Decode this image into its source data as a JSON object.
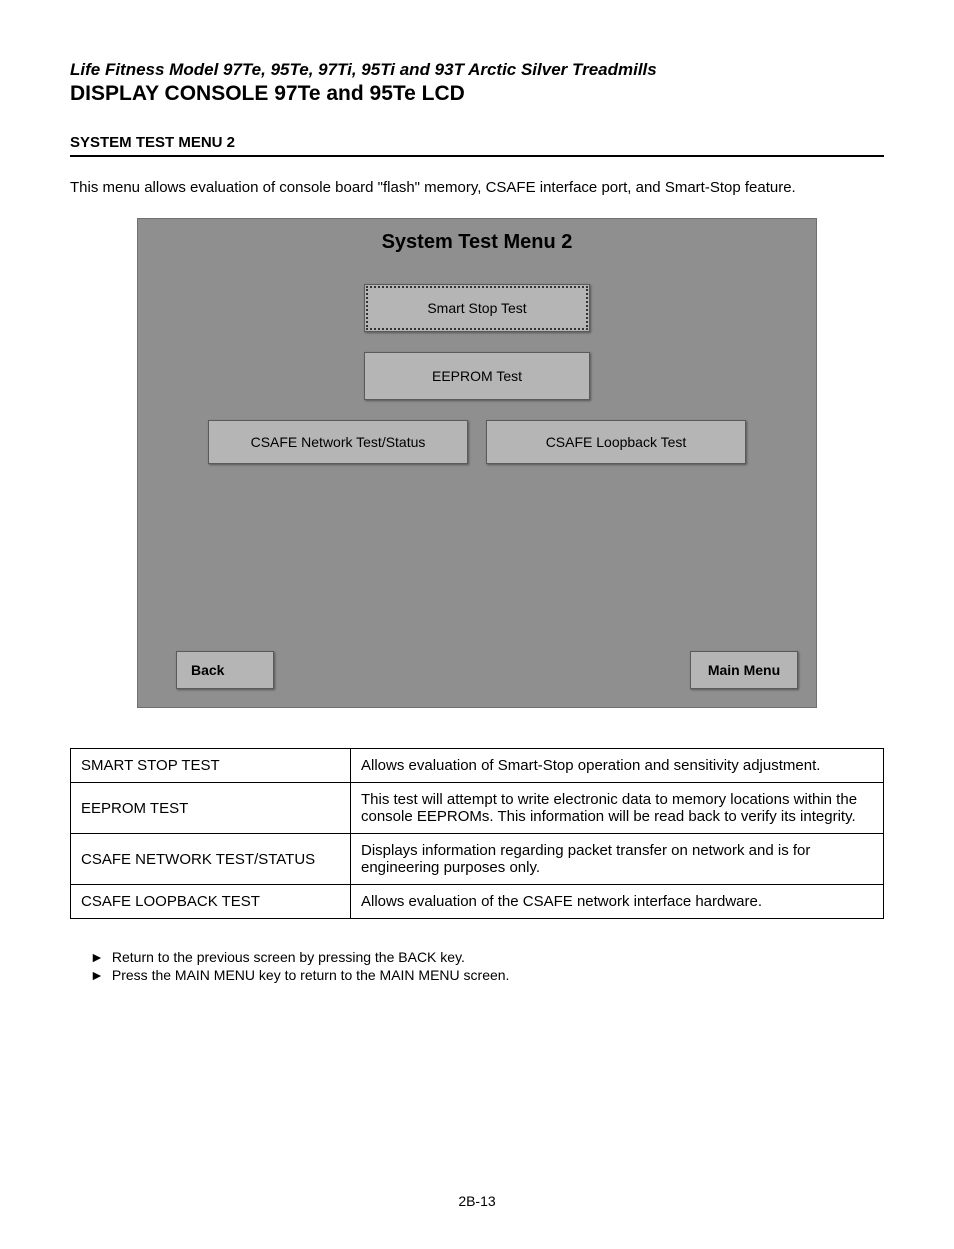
{
  "header": {
    "subtitle": "Life Fitness Model 97Te, 95Te, 97Ti, 95Ti and 93T Arctic Silver Treadmills",
    "title": "DISPLAY CONSOLE 97Te and 95Te LCD"
  },
  "section_heading": "SYSTEM TEST MENU 2",
  "intro_text": "This menu allows evaluation of console board \"flash\" memory, CSAFE interface port, and Smart-Stop feature.",
  "console": {
    "title": "System Test Menu 2",
    "smart_stop": "Smart Stop Test",
    "eeprom": "EEPROM Test",
    "csafe_network": "CSAFE Network Test/Status",
    "csafe_loopback": "CSAFE Loopback Test",
    "back": "Back",
    "main_menu": "Main Menu"
  },
  "table": {
    "rows": [
      {
        "label": "SMART STOP TEST",
        "desc": "Allows evaluation of Smart-Stop operation and sensitivity adjustment."
      },
      {
        "label": "EEPROM TEST",
        "desc": "This test will attempt to write electronic data to memory locations within the console EEPROMs. This information will be read back to verify its integrity."
      },
      {
        "label": "CSAFE NETWORK TEST/STATUS",
        "desc": "Displays information regarding packet transfer on network and is for engineering purposes only."
      },
      {
        "label": "CSAFE LOOPBACK TEST",
        "desc": "Allows evaluation of the CSAFE network interface hardware."
      }
    ]
  },
  "notes": [
    "Return to the previous screen by pressing the BACK key.",
    "Press the MAIN MENU key to return to the MAIN MENU screen."
  ],
  "page_number": "2B-13"
}
